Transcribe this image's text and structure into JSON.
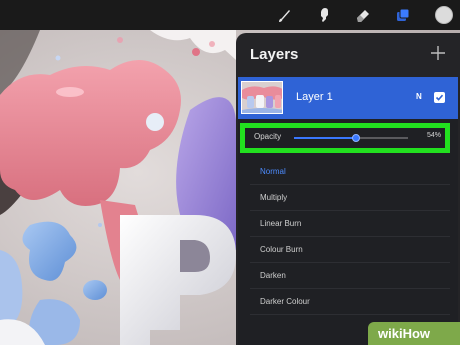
{
  "toolbar": {
    "tools": [
      {
        "icon": "brush-icon"
      },
      {
        "icon": "smudge-icon"
      },
      {
        "icon": "eraser-icon"
      },
      {
        "icon": "layers-icon",
        "active": true
      },
      {
        "icon": "color-swatch-icon"
      }
    ],
    "active_color": "#2f63d6",
    "swatch_color": "#dcdcdc"
  },
  "layers_panel": {
    "title": "Layers",
    "add_icon": "plus-icon",
    "layers": [
      {
        "name": "Layer 1",
        "blend_mode_letter": "N",
        "visible": true,
        "selected": true
      }
    ],
    "opacity": {
      "label": "Opacity",
      "value_text": "54%",
      "value": 0.54
    },
    "blend_modes": [
      {
        "label": "Normal",
        "selected": true
      },
      {
        "label": "Multiply"
      },
      {
        "label": "Linear Burn"
      },
      {
        "label": "Colour Burn"
      },
      {
        "label": "Darken"
      },
      {
        "label": "Darker Colour"
      }
    ]
  },
  "colors": {
    "selection_blue": "#2f63d6",
    "highlight_green": "#22e01f",
    "panel_bg": "#242427",
    "watermark_green": "#7ea94a"
  },
  "watermark": {
    "prefix": "wiki",
    "suffix": "How"
  }
}
